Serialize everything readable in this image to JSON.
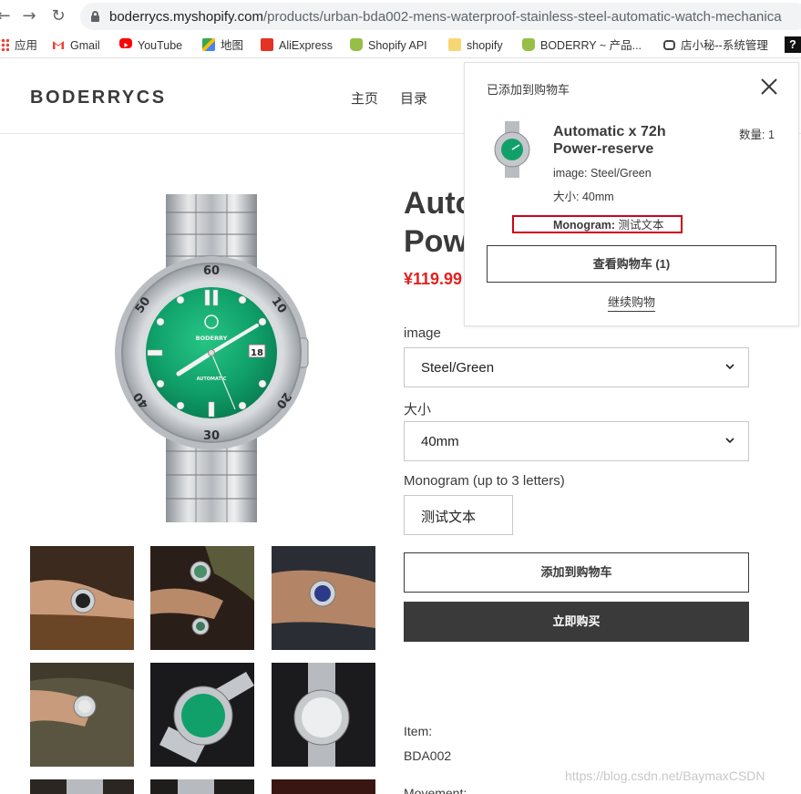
{
  "browser": {
    "url_domain": "boderrycs.myshopify.com",
    "url_path": "/products/urban-bda002-mens-waterproof-stainless-steel-automatic-watch-mechanica",
    "bookmarks": [
      {
        "label": "应用",
        "icon": "apps-grid-icon"
      },
      {
        "label": "Gmail",
        "icon": "gmail-icon"
      },
      {
        "label": "YouTube",
        "icon": "youtube-icon"
      },
      {
        "label": "地图",
        "icon": "maps-icon"
      },
      {
        "label": "AliExpress",
        "icon": "aliexpress-icon"
      },
      {
        "label": "Shopify API",
        "icon": "shopify-icon"
      },
      {
        "label": "shopify",
        "icon": "folder-icon"
      },
      {
        "label": "BODERRY ~ 产品...",
        "icon": "shopify-icon"
      },
      {
        "label": "店小秘--系统管理",
        "icon": "robot-icon"
      }
    ]
  },
  "header": {
    "logo": "BODERRYCS",
    "nav": [
      "主页",
      "目录"
    ]
  },
  "product": {
    "title_line1": "Auto",
    "title_line2": "Pow",
    "price": "¥119.99",
    "options": [
      {
        "label": "image",
        "value": "Steel/Green"
      },
      {
        "label": "大小",
        "value": "40mm"
      }
    ],
    "monogram_label": "Monogram (up to 3 letters)",
    "monogram_value": "测试文本",
    "add_to_cart": "添加到购物车",
    "buy_now": "立即购买",
    "item_label": "Item:",
    "item_value": "BDA002",
    "movement_label": "Movement:"
  },
  "cart_popup": {
    "header": "已添加到购物车",
    "product_name": "Automatic x 72h Power-reserve",
    "qty_label": "数量: 1",
    "opt_image": "image: Steel/Green",
    "opt_size": "大小: 40mm",
    "monogram_key": "Monogram:",
    "monogram_value": "测试文本",
    "view_cart": "查看购物车 (1)",
    "continue": "继续购物"
  },
  "watch": {
    "dial_marks": [
      "60",
      "10",
      "20",
      "30",
      "40",
      "50"
    ],
    "dial_brand": "BODERRY",
    "dial_text": "AUTOMATIC",
    "date": "18"
  },
  "watermark": "https://blog.csdn.net/BaymaxCSDN",
  "colors": {
    "accent_red": "#e22120",
    "highlight_red": "#d0021b",
    "dial_green": "#12a06a",
    "button_dark": "#3a3a3a"
  }
}
